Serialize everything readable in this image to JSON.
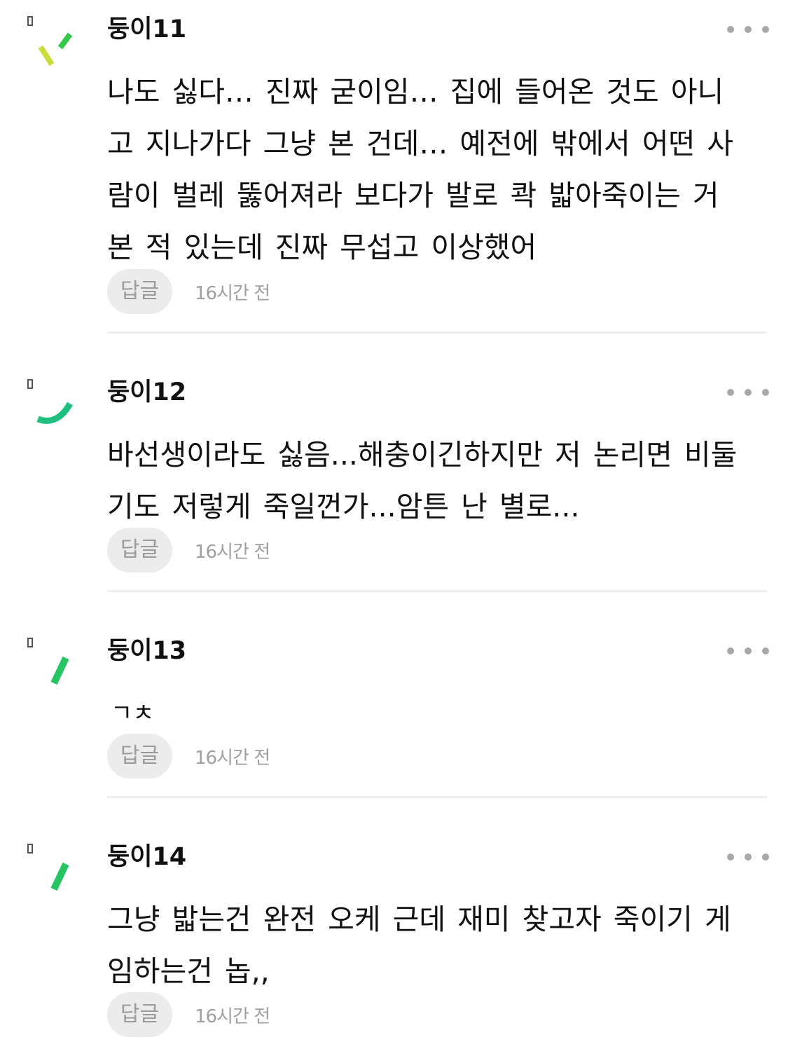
{
  "comments": [
    {
      "username": "둥이11",
      "lines": [
        "나도 싫다… 진짜 굳이임… 집에 들어온 것도 아니",
        "고 지나가다 그냥 본 건데… 예전에 밖에서 어떤 사",
        "람이 벌레 뚫어져라 보다가 발로 콱 밟아죽이는 거",
        "본 적 있는데 진짜 무섭고 이상했어"
      ],
      "reply_label": "답글",
      "timestamp": "16시간 전",
      "avatar_icon": "green-dashes-icon"
    },
    {
      "username": "둥이12",
      "lines": [
        "바선생이라도 싫음...해충이긴하지만 저 논리면 비둘",
        "기도 저렇게 죽일껀가...암튼 난 별로..."
      ],
      "reply_label": "답글",
      "timestamp": "16시간 전",
      "avatar_icon": "green-arc-icon"
    },
    {
      "username": "둥이13",
      "lines": [
        "ㄱㅊ"
      ],
      "reply_label": "답글",
      "timestamp": "16시간 전",
      "avatar_icon": "green-dash-icon"
    },
    {
      "username": "둥이14",
      "lines": [
        "그냥 밟는건 완전 오케 근데 재미 찾고자 죽이기 게",
        "임하는건 놉,,"
      ],
      "reply_label": "답글",
      "timestamp": "16시간 전",
      "avatar_icon": "green-dash-icon"
    }
  ],
  "colors": {
    "accent_green": "#1fbf80",
    "accent_lime": "#c8dd3c",
    "accent_bright_green": "#35c84a",
    "reply_bg": "#ececec",
    "muted_text": "#a0a0a0",
    "divider": "#eeeeee"
  }
}
